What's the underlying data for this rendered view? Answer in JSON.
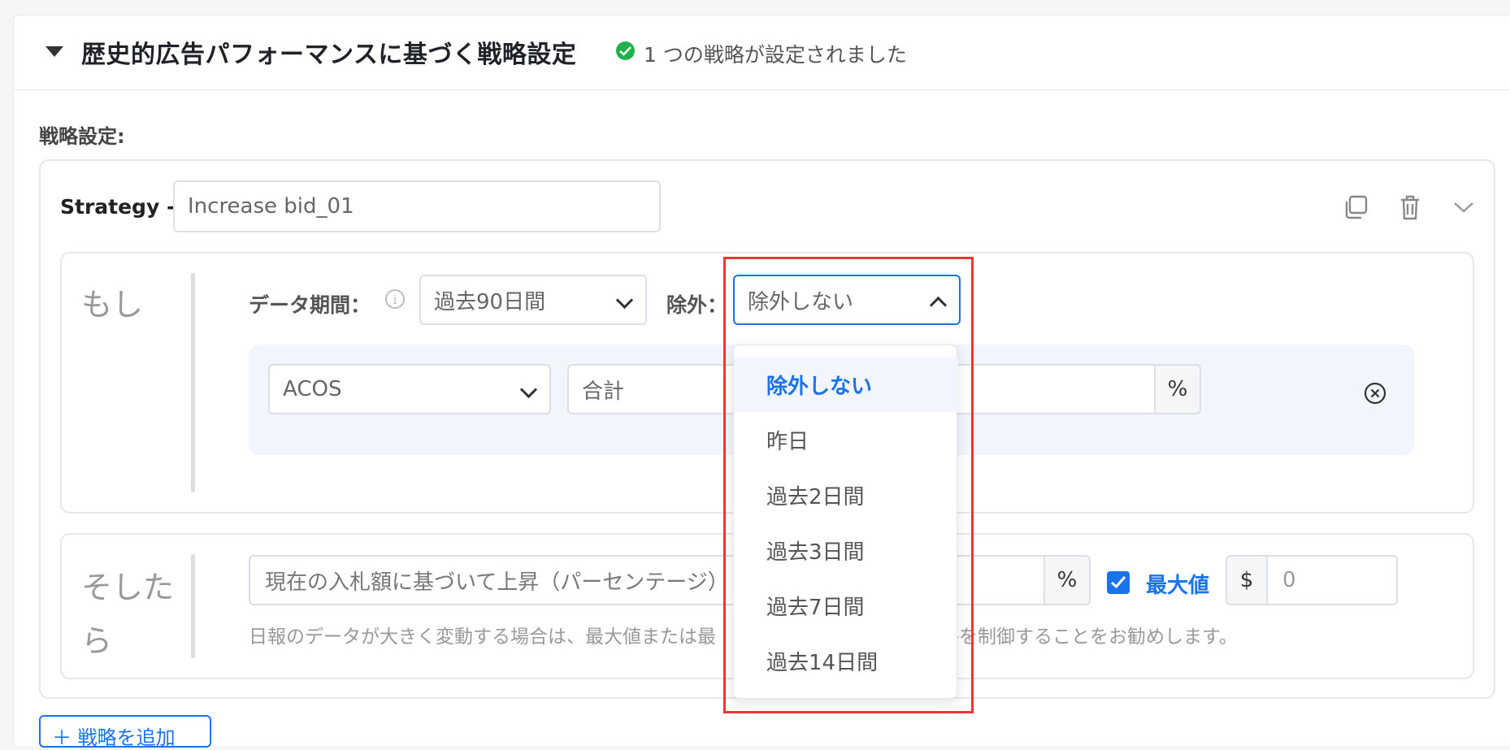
{
  "header": {
    "title": "歴史的広告パフォーマンスに基づく戦略設定",
    "status_text": "1 つの戦略が設定されました",
    "status_color": "#22b14c"
  },
  "settings_label": "戦略設定:",
  "strategy": {
    "label": "Strategy -",
    "name_value": "Increase bid_01",
    "actions": [
      "copy-icon",
      "trash-icon",
      "chevron-down-icon"
    ]
  },
  "if_block": {
    "label": "もし",
    "data_period_label": "データ期間：",
    "data_period_value": "過去90日間",
    "exclude_label": "除外：",
    "exclude_value": "除外しない",
    "condition": {
      "metric": "ACOS",
      "aggregation": "合計",
      "unit": "%"
    }
  },
  "exclude_dropdown": {
    "options": [
      "除外しない",
      "昨日",
      "過去2日間",
      "過去3日間",
      "過去7日間",
      "過去14日間"
    ],
    "selected": "除外しない"
  },
  "then_block": {
    "label_line1": "そした",
    "label_line2": "ら",
    "action_value": "現在の入札額に基づいて上昇（パーセンテージ）",
    "unit": "%",
    "max_checked": true,
    "max_label": "最大値",
    "currency": "$",
    "max_value": "0",
    "hint": "日報のデータが大きく変動する場合は、最大値または最　　　　　　　　　　　価格を制御することをお勧めします。"
  },
  "add_strategy_label": "＋ 戦略を追加",
  "colors": {
    "accent": "#1a73e8",
    "highlight_box": "#e53935"
  }
}
